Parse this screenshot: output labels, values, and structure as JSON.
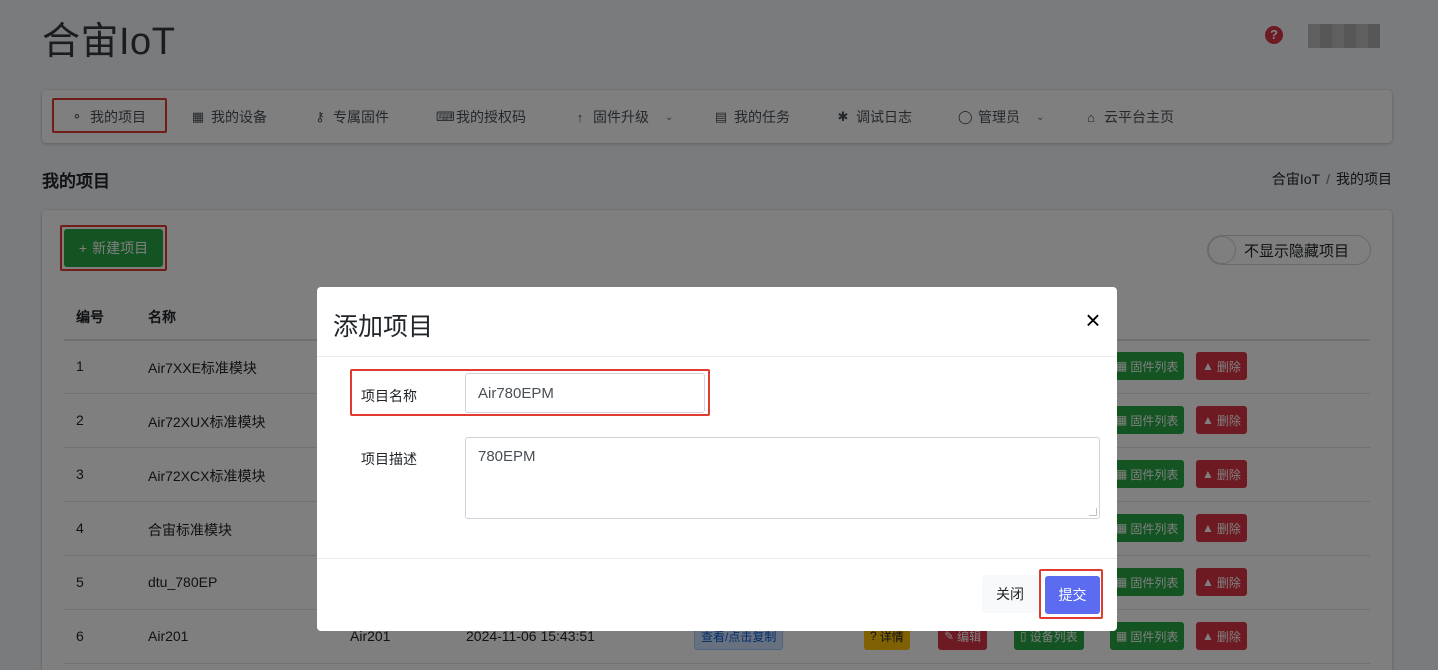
{
  "app": {
    "title": "合宙IoT",
    "help_icon": "question-circle-icon"
  },
  "nav": {
    "items": [
      {
        "label": "我的项目",
        "icon": "lightbulb-icon"
      },
      {
        "label": "我的设备",
        "icon": "chip-icon"
      },
      {
        "label": "专属固件",
        "icon": "key-icon"
      },
      {
        "label": "我的授权码",
        "icon": "keyboard-icon"
      },
      {
        "label": "固件升级",
        "icon": "arrow-up-icon"
      },
      {
        "label": "我的任务",
        "icon": "calendar-icon"
      },
      {
        "label": "调试日志",
        "icon": "bug-icon"
      },
      {
        "label": "管理员",
        "icon": "user-icon"
      },
      {
        "label": "云平台主页",
        "icon": "home-icon"
      }
    ]
  },
  "page": {
    "heading": "我的项目",
    "breadcrumb": {
      "root": "合宙IoT",
      "separator": "/",
      "current": "我的项目"
    },
    "new_button": "新建项目",
    "toggle_label": "不显示隐藏项目"
  },
  "table": {
    "headers": [
      "编号",
      "名称"
    ],
    "rows": [
      {
        "id": "1",
        "name": "Air7XXE标准模块"
      },
      {
        "id": "2",
        "name": "Air72XUX标准模块"
      },
      {
        "id": "3",
        "name": "Air72XCX标准模块"
      },
      {
        "id": "4",
        "name": "合宙标准模块"
      },
      {
        "id": "5",
        "name": "dtu_780EP"
      },
      {
        "id": "6",
        "name": "Air201",
        "model": "Air201",
        "time": "2024-11-06 15:43:51",
        "copy": "查看/点击复制",
        "detail": "详情",
        "edit": "编辑",
        "devices": "设备列表"
      }
    ],
    "actions": {
      "firmware": "固件列表",
      "delete": "删除"
    }
  },
  "modal": {
    "title": "添加项目",
    "name_label": "项目名称",
    "name_value": "Air780EPM",
    "desc_label": "项目描述",
    "desc_value": "780EPM",
    "close_button": "关闭",
    "submit_button": "提交"
  },
  "colors": {
    "highlight": "#e03b2e",
    "primary": "#5b6cf0",
    "success": "#28a745",
    "danger": "#dc3545"
  }
}
